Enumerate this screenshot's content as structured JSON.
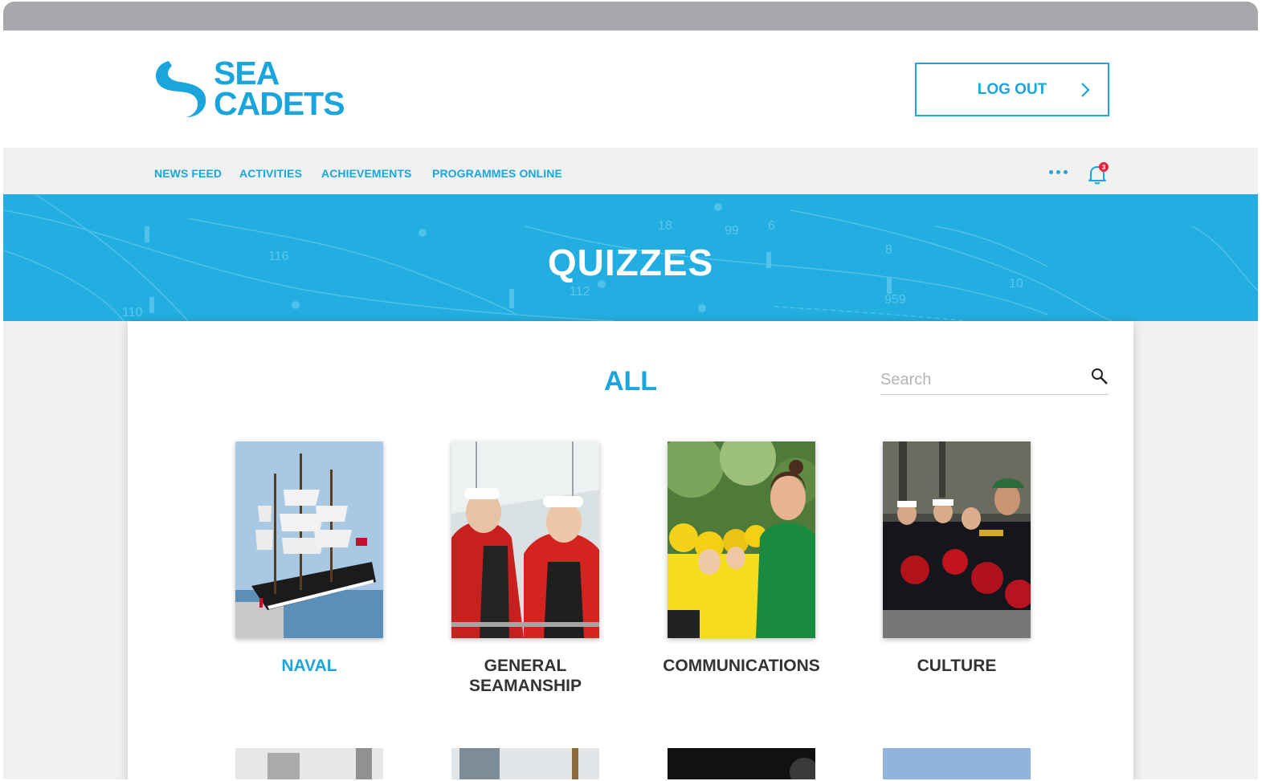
{
  "brand": {
    "line1": "SEA",
    "line2": "CADETS",
    "color": "#1aa6dc"
  },
  "header": {
    "logout_label": "LOG OUT"
  },
  "nav": {
    "items": [
      "NEWS FEED",
      "ACTIVITIES",
      "ACHIEVEMENTS",
      "PROGRAMMES ONLINE"
    ],
    "more_icon": "ellipsis-icon",
    "notifications": {
      "icon": "bell-icon",
      "count": "3"
    }
  },
  "banner": {
    "title": "QUIZZES",
    "chart_numbers": [
      "116",
      "112",
      "110",
      "99",
      "6",
      "8",
      "10",
      "959",
      "18"
    ]
  },
  "main": {
    "heading": "ALL",
    "search_placeholder": "Search",
    "categories": [
      {
        "label": "NAVAL",
        "active": true
      },
      {
        "label": "GENERAL SEAMANSHIP",
        "active": false
      },
      {
        "label": "COMMUNICATIONS",
        "active": false
      },
      {
        "label": "CULTURE",
        "active": false
      }
    ]
  },
  "colors": {
    "accent": "#1aa6dc",
    "banner": "#22aee1",
    "badge": "#e3263a",
    "text": "#333333"
  }
}
